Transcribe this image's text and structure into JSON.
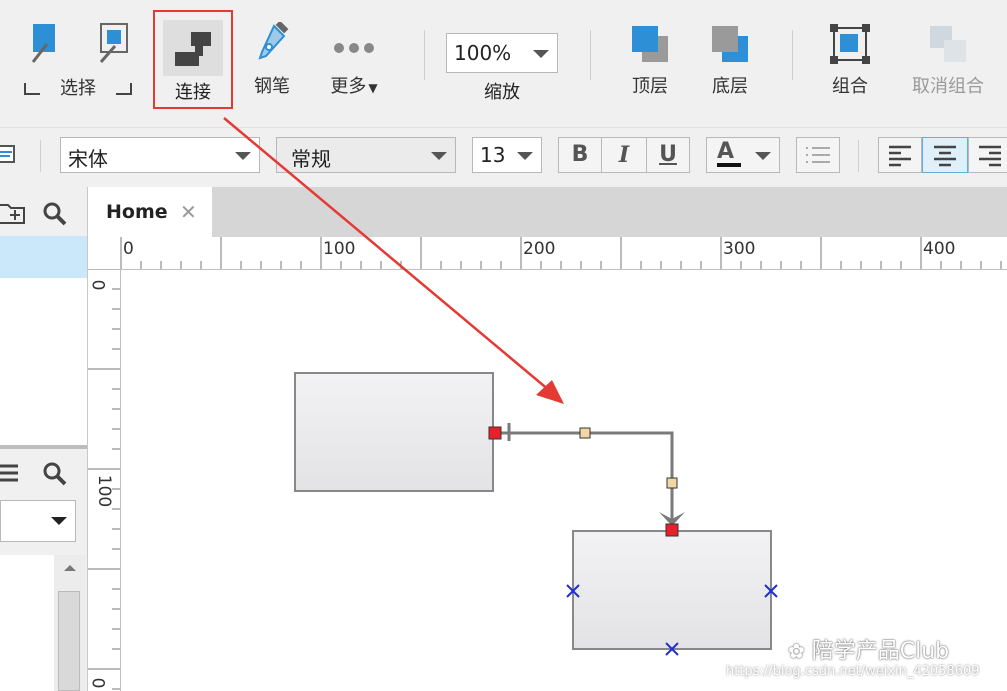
{
  "toolbar": {
    "select_label": "选择",
    "connect_label": "连接",
    "pen_label": "钢笔",
    "more_label": "更多",
    "zoom_value": "100%",
    "zoom_label": "缩放",
    "front_label": "顶层",
    "back_label": "底层",
    "group_label": "组合",
    "ungroup_label": "取消组合"
  },
  "format": {
    "font_family": "宋体",
    "font_style": "常规",
    "font_size": "13",
    "bold": "B",
    "italic": "I",
    "underline": "U",
    "font_color": "A"
  },
  "tabs": [
    {
      "label": "Home"
    }
  ],
  "ruler": {
    "h_labels": [
      "0",
      "100",
      "200",
      "300",
      "400"
    ],
    "v_labels": [
      "0",
      "100",
      "0"
    ]
  },
  "watermark": {
    "brand": "陪学产品Club",
    "url": "https://blog.csdn.net/weixin_42058609"
  },
  "colors": {
    "highlight_box": "#e53935",
    "annotation_arrow": "#e53935",
    "connector": "#7a7a7a",
    "endpoint": "#e8202a",
    "midpoint": "#f2d7a6",
    "connection_point": "#1f2fd0",
    "icon_blue": "#2d8fd6",
    "selected_row": "#cbe8fb"
  }
}
